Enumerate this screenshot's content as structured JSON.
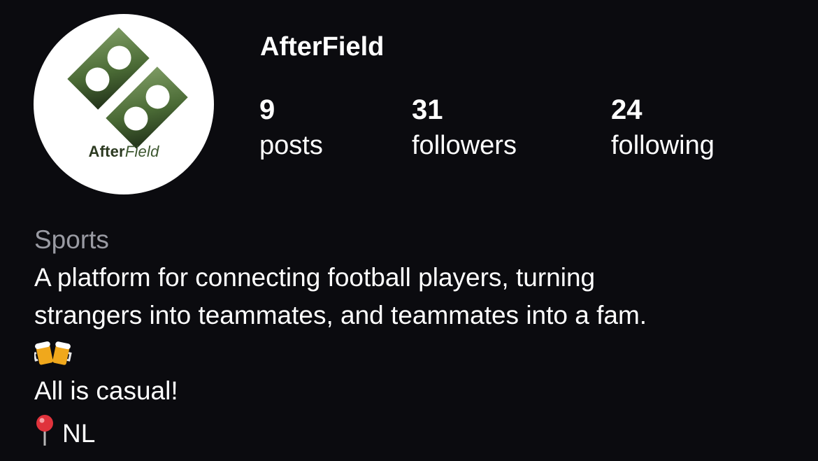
{
  "profile": {
    "username": "AfterField",
    "avatar_logo_text_bold": "After",
    "avatar_logo_text_light": "Field",
    "stats": {
      "posts": {
        "count": "9",
        "label": "posts"
      },
      "followers": {
        "count": "31",
        "label": "followers"
      },
      "following": {
        "count": "24",
        "label": "following"
      }
    },
    "category": "Sports",
    "bio": {
      "line1": "A platform for connecting football players, turning",
      "line2": "strangers into teammates, and teammates into a fam.",
      "emoji_icon": "beer-mugs-icon",
      "line3": "All is casual!",
      "location_icon": "round-pushpin-icon",
      "location": "NL"
    }
  },
  "colors": {
    "background": "#0b0b0f",
    "text_primary": "#ffffff",
    "text_secondary": "#9a9ba3",
    "logo_green": "#3d5730"
  }
}
